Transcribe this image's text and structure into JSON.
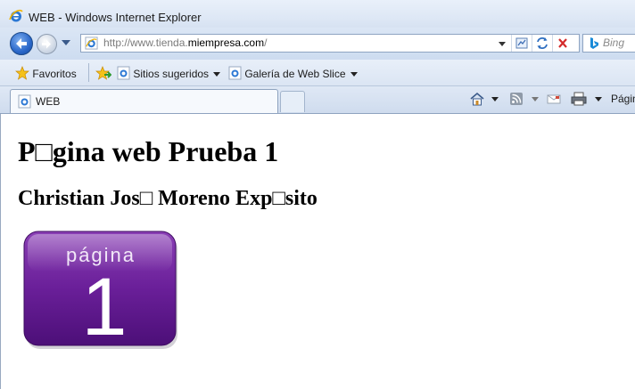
{
  "window": {
    "title": "WEB - Windows Internet Explorer"
  },
  "address_bar": {
    "url_prefix": "http://www.tienda.",
    "url_domain": "miempresa.com",
    "url_suffix": "/",
    "search_provider": "Bing"
  },
  "favorites_bar": {
    "favorites_label": "Favoritos",
    "suggested_sites_label": "Sitios sugeridos",
    "web_slice_gallery_label": "Galería de Web Slice"
  },
  "tabs": [
    {
      "label": "WEB"
    }
  ],
  "command_bar": {
    "page_label": "Págin"
  },
  "page": {
    "heading": "P□gina web Prueba 1",
    "subheading": "Christian Jos□ Moreno Exp□sito",
    "image_text_word": "página",
    "image_text_number": "1"
  }
}
